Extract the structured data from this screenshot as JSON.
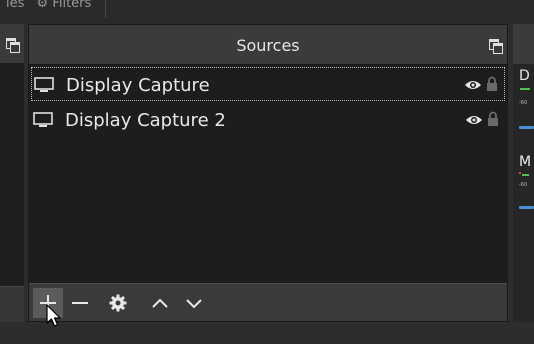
{
  "top_tabs": {
    "partial_tab_left": "ies",
    "partial_tab_filters": "Filters"
  },
  "sources": {
    "title": "Sources",
    "items": [
      {
        "label": "Display Capture",
        "selected": true,
        "visible": true,
        "locked": true
      },
      {
        "label": "Display Capture 2",
        "selected": false,
        "visible": true,
        "locked": true
      }
    ]
  },
  "footer_buttons": [
    "add-icon",
    "remove-icon",
    "gear-icon",
    "chevron-up-icon",
    "chevron-down-icon"
  ],
  "mixer": {
    "channels": [
      {
        "label": "D",
        "meter_tick": "-60"
      },
      {
        "label": "M",
        "meter_tick": "-60"
      }
    ]
  },
  "colors": {
    "accent": "#4a8fd6",
    "meter_green": "#4fc24f",
    "meter_red": "#e04646"
  }
}
